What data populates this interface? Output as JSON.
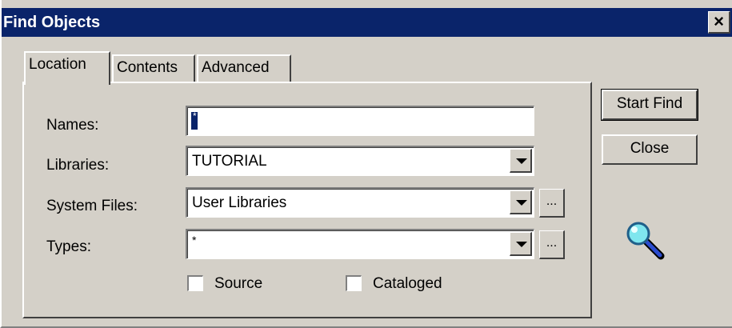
{
  "window": {
    "title": "Find Objects",
    "close_glyph": "×"
  },
  "tabs": [
    {
      "label": "Location",
      "active": true
    },
    {
      "label": "Contents",
      "active": false
    },
    {
      "label": "Advanced",
      "active": false
    }
  ],
  "form": {
    "names_label": "Names:",
    "names_value": "*",
    "libraries_label": "Libraries:",
    "libraries_value": "TUTORIAL",
    "system_files_label": "System Files:",
    "system_files_value": "User Libraries",
    "types_label": "Types:",
    "types_value": "*",
    "ellipsis": "...",
    "source_label": "Source",
    "cataloged_label": "Cataloged",
    "source_checked": false,
    "cataloged_checked": false
  },
  "buttons": {
    "start_find": "Start Find",
    "close": "Close"
  },
  "icons": {
    "search_icon": "magnifying-glass"
  },
  "colors": {
    "titlebar": "#0a246a",
    "face": "#d4d0c8"
  }
}
